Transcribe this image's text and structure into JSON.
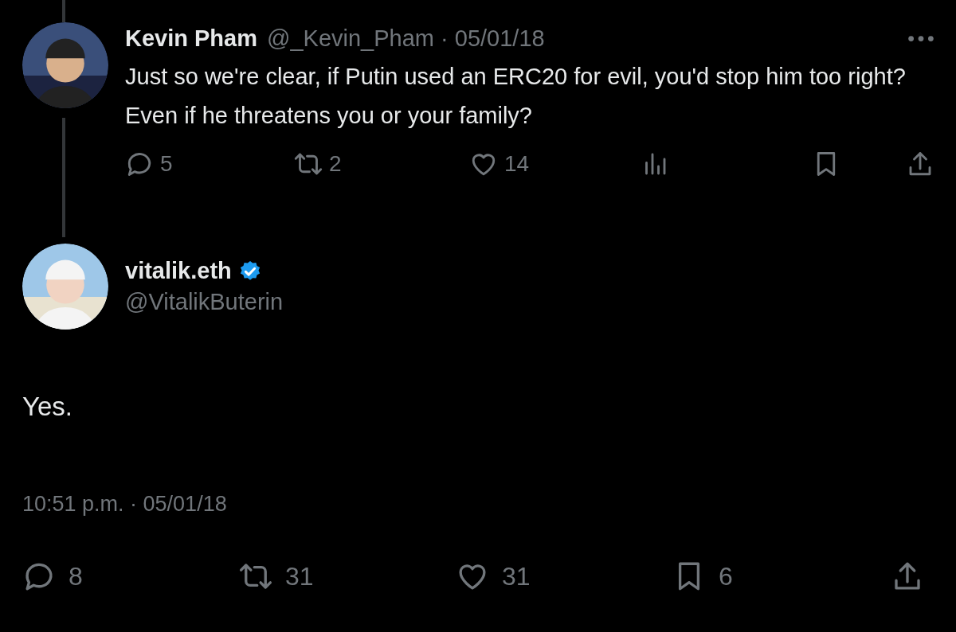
{
  "parent_tweet": {
    "name": "Kevin Pham",
    "meta": "@_Kevin_Pham · 05/01/18",
    "text": "Just so we're clear, if Putin used an ERC20 for evil, you'd stop him too right? Even if he threatens you or your family?",
    "actions": [
      {
        "kind": "reply",
        "count": "5"
      },
      {
        "kind": "retweet",
        "count": "2"
      },
      {
        "kind": "like",
        "count": "14"
      },
      {
        "kind": "views"
      },
      {
        "kind": "bookmark"
      },
      {
        "kind": "share"
      }
    ]
  },
  "main_tweet": {
    "name": "vitalik.eth",
    "verified": true,
    "handle": "@VitalikButerin",
    "text": "Yes.",
    "timestamp": "10:51 p.m. · 05/01/18",
    "actions": [
      {
        "kind": "reply",
        "count": "8"
      },
      {
        "kind": "retweet",
        "count": "31"
      },
      {
        "kind": "like",
        "count": "31"
      },
      {
        "kind": "bookmark",
        "count": "6"
      },
      {
        "kind": "share"
      }
    ]
  }
}
